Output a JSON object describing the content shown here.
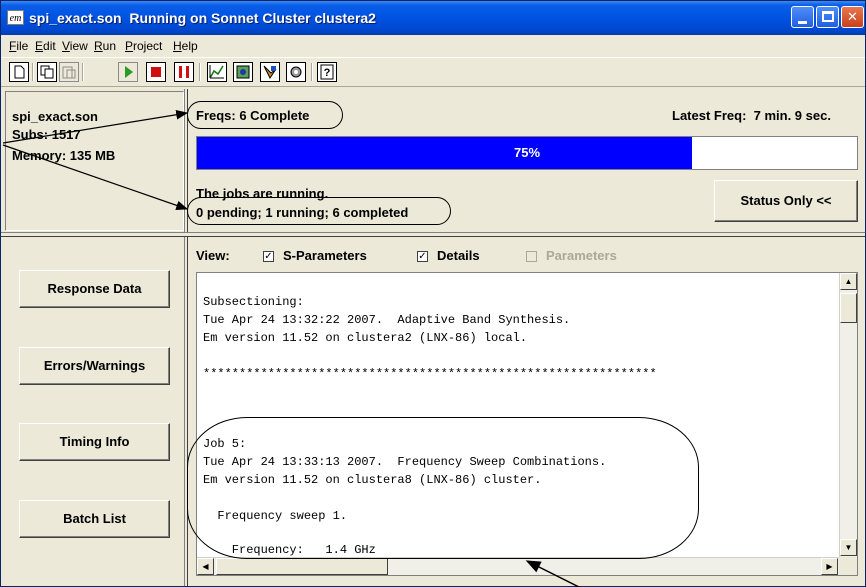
{
  "window": {
    "app_icon_text": "em",
    "title": "spi_exact.son  Running on Sonnet Cluster clustera2",
    "controls": {
      "minimize": "",
      "maximize": "",
      "close": "✕"
    }
  },
  "menu": [
    {
      "label": "File"
    },
    {
      "label": "Edit"
    },
    {
      "label": "View"
    },
    {
      "label": "Run"
    },
    {
      "label": "Project"
    },
    {
      "label": "Help"
    }
  ],
  "toolbar_icons": [
    "new-icon",
    "copy-icon",
    "paste-icon",
    "run-icon",
    "stop-icon",
    "pause-icon",
    "response-icon",
    "current-icon",
    "layout-icon",
    "settings-icon",
    "help-icon"
  ],
  "info": {
    "filename": "spi_exact.son",
    "subs": "Subs: 1517",
    "memory": "Memory: 135 MB"
  },
  "status": {
    "freqs": "Freqs:  6 Complete",
    "latest_freq": "Latest Freq:  7 min. 9 sec.",
    "progress_percent": 75,
    "progress_label": "75%",
    "jobs_state": "The jobs are running.",
    "jobs_counts": "0 pending; 1 running; 6 completed",
    "status_button": "Status Only <<"
  },
  "nav": {
    "response_data": "Response Data",
    "errors_warnings": "Errors/Warnings",
    "timing_info": "Timing Info",
    "batch_list": "Batch List"
  },
  "view": {
    "label": "View:",
    "options": [
      {
        "label": "S-Parameters",
        "checked": true,
        "enabled": true
      },
      {
        "label": "Details",
        "checked": true,
        "enabled": true
      },
      {
        "label": "Parameters",
        "checked": false,
        "enabled": false
      }
    ]
  },
  "log": {
    "lines": [
      "Subsectioning:",
      "Tue Apr 24 13:32:22 2007.  Adaptive Band Synthesis.",
      "Em version 11.52 on clustera2 (LNX-86) local.",
      "",
      "***************************************************************",
      "",
      "",
      "Job 5:",
      "Tue Apr 24 13:33:13 2007.  Frequency Sweep Combinations.",
      "Em version 11.52 on clustera8 (LNX-86) cluster.",
      "",
      "  Frequency sweep 1.",
      "",
      "    Frequency:   1.4 GHz"
    ]
  }
}
